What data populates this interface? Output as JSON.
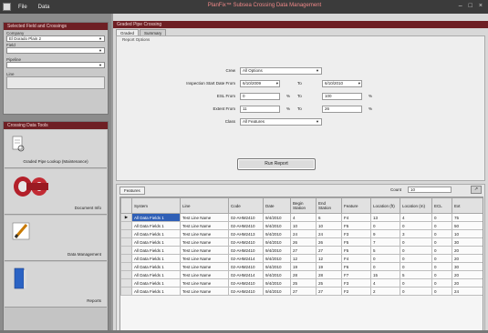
{
  "window": {
    "menu": [
      "File",
      "Data"
    ],
    "title": "PlanFix™ Subsea Crossing Data Management"
  },
  "left": {
    "selection_header": "Selected Field and Crossings",
    "fields": [
      {
        "label": "Company",
        "value": "El Dorado Plain 2"
      },
      {
        "label": "Field",
        "value": ""
      },
      {
        "label": "Pipeline",
        "value": ""
      },
      {
        "label": "Line",
        "value": ""
      }
    ],
    "tools_header": "Crossing Data Tools",
    "tools": [
      {
        "label": "Graded Pipe Lookup (Maintenance)",
        "icon": "document-lookup-icon"
      },
      {
        "label": "Document Info",
        "icon": "pipe-crossing-icon"
      },
      {
        "label": "Data Management",
        "icon": "pencil-icon"
      },
      {
        "label": "Reports",
        "icon": "report-book-icon"
      }
    ]
  },
  "main": {
    "header": "Graded Pipe Crossing",
    "tabs": [
      "Graded",
      "Summary"
    ],
    "form_caption": "Report Options",
    "form": {
      "crew_label": "Crew",
      "crew_value": "All Options",
      "date_label": "Inspection Start Date From",
      "date_from": "6/10/2009",
      "date_to": "6/10/2010",
      "to_label": "To",
      "esl_label": "ESL From",
      "esl_from": "0",
      "esl_to": "100",
      "extent_label": "Extent From",
      "extent_from": "11",
      "extent_to": "26",
      "pct": "%",
      "class_label": "Class",
      "class_value": "All Features",
      "run_button": "Run Report"
    },
    "grid": {
      "tab": "Features",
      "count_label": "Count",
      "count_value": "10",
      "export_icon": "export-icon",
      "columns": [
        "System",
        "Line",
        "Code",
        "Date",
        "Begin Station",
        "End Station",
        "Feature",
        "Location (ft)",
        "Location (m)",
        "ECL",
        "Ext"
      ],
      "rows": [
        [
          "All Data Fields 1",
          "Test Line Name",
          "02-AHM2410",
          "9/4/2010",
          "4",
          "6",
          "F4",
          "13",
          "4",
          "0",
          "75"
        ],
        [
          "All Data Fields 1",
          "Test Line Name",
          "02-AHM2410",
          "9/4/2010",
          "10",
          "10",
          "F5",
          "0",
          "0",
          "0",
          "50"
        ],
        [
          "All Data Fields 1",
          "Test Line Name",
          "02-AHM2413",
          "9/4/2010",
          "24",
          "24",
          "F3",
          "9",
          "3",
          "0",
          "10"
        ],
        [
          "All Data Fields 1",
          "Test Line Name",
          "02-AHM2410",
          "9/4/2010",
          "26",
          "26",
          "F5",
          "7",
          "0",
          "0",
          "30"
        ],
        [
          "All Data Fields 1",
          "Test Line Name",
          "02-AHM2410",
          "9/4/2010",
          "27",
          "27",
          "F5",
          "5",
          "0",
          "0",
          "20"
        ],
        [
          "All Data Fields 1",
          "Test Line Name",
          "02-AHM2414",
          "9/4/2010",
          "12",
          "12",
          "F4",
          "0",
          "0",
          "0",
          "20"
        ],
        [
          "All Data Fields 1",
          "Test Line Name",
          "02-AHM2410",
          "9/4/2010",
          "19",
          "19",
          "F6",
          "0",
          "0",
          "0",
          "30"
        ],
        [
          "All Data Fields 1",
          "Test Line Name",
          "02-AHM2414",
          "9/4/2010",
          "28",
          "28",
          "F7",
          "15",
          "5",
          "0",
          "20"
        ],
        [
          "All Data Fields 1",
          "Test Line Name",
          "02-AHM2410",
          "9/4/2010",
          "25",
          "25",
          "F3",
          "4",
          "0",
          "0",
          "20"
        ],
        [
          "All Data Fields 1",
          "Test Line Name",
          "02-AHM2410",
          "9/4/2010",
          "27",
          "27",
          "F2",
          "2",
          "0",
          "0",
          "24"
        ]
      ]
    }
  },
  "colors": {
    "header_maroon": "#6e1f24",
    "selection_blue": "#2f5fb6"
  }
}
